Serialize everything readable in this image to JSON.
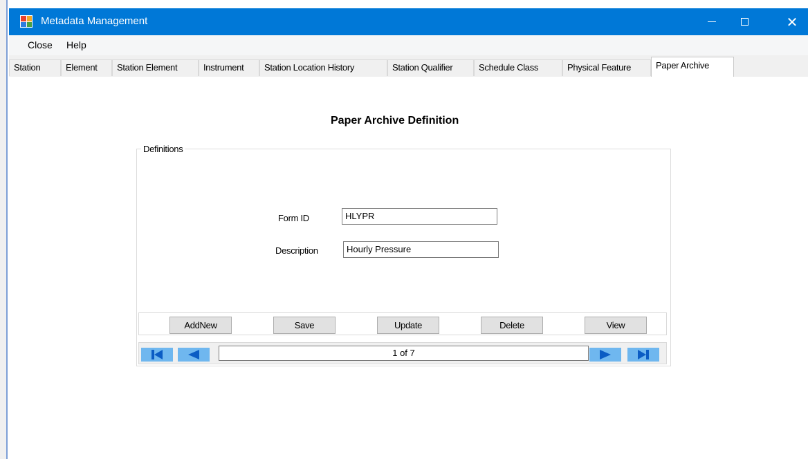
{
  "window": {
    "title": "Metadata Management",
    "minimize_icon": "minimize-icon",
    "maximize_icon": "maximize-icon",
    "close_glyph": "✕"
  },
  "menu": {
    "items": [
      "Close",
      "Help"
    ]
  },
  "tabs": [
    "Station",
    "Element",
    "Station Element",
    "Instrument",
    "Station Location History",
    "Station Qualifier",
    "Schedule Class",
    "Physical Feature",
    "Paper Archive"
  ],
  "active_tab": "Paper Archive",
  "form": {
    "title": "Paper Archive Definition",
    "group_label": "Definitions",
    "form_id_label": "Form ID",
    "form_id_value": "HLYPR",
    "description_label": "Description",
    "description_value": "Hourly Pressure"
  },
  "buttons": {
    "add_new": "AddNew",
    "save": "Save",
    "update": "Update",
    "delete": "Delete",
    "view": "View"
  },
  "navigator": {
    "record_text": "1 of 7",
    "current_record": 1,
    "total_records": 7
  },
  "colors": {
    "title_bar": "#0078d7",
    "nav_button": "#6fb7ef",
    "nav_glyph": "#0b5cc4"
  }
}
